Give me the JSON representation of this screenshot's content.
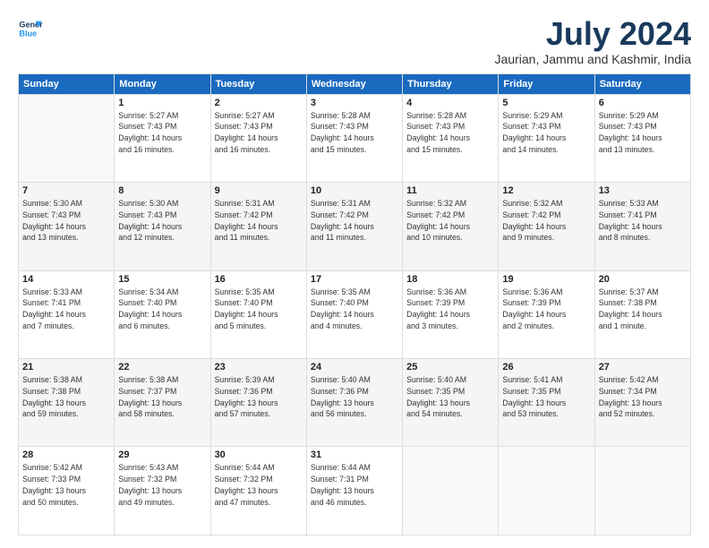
{
  "logo": {
    "line1": "General",
    "line2": "Blue"
  },
  "title": "July 2024",
  "location": "Jaurian, Jammu and Kashmir, India",
  "days_of_week": [
    "Sunday",
    "Monday",
    "Tuesday",
    "Wednesday",
    "Thursday",
    "Friday",
    "Saturday"
  ],
  "weeks": [
    [
      {
        "day": "",
        "info": ""
      },
      {
        "day": "1",
        "info": "Sunrise: 5:27 AM\nSunset: 7:43 PM\nDaylight: 14 hours\nand 16 minutes."
      },
      {
        "day": "2",
        "info": "Sunrise: 5:27 AM\nSunset: 7:43 PM\nDaylight: 14 hours\nand 16 minutes."
      },
      {
        "day": "3",
        "info": "Sunrise: 5:28 AM\nSunset: 7:43 PM\nDaylight: 14 hours\nand 15 minutes."
      },
      {
        "day": "4",
        "info": "Sunrise: 5:28 AM\nSunset: 7:43 PM\nDaylight: 14 hours\nand 15 minutes."
      },
      {
        "day": "5",
        "info": "Sunrise: 5:29 AM\nSunset: 7:43 PM\nDaylight: 14 hours\nand 14 minutes."
      },
      {
        "day": "6",
        "info": "Sunrise: 5:29 AM\nSunset: 7:43 PM\nDaylight: 14 hours\nand 13 minutes."
      }
    ],
    [
      {
        "day": "7",
        "info": "Sunrise: 5:30 AM\nSunset: 7:43 PM\nDaylight: 14 hours\nand 13 minutes."
      },
      {
        "day": "8",
        "info": "Sunrise: 5:30 AM\nSunset: 7:43 PM\nDaylight: 14 hours\nand 12 minutes."
      },
      {
        "day": "9",
        "info": "Sunrise: 5:31 AM\nSunset: 7:42 PM\nDaylight: 14 hours\nand 11 minutes."
      },
      {
        "day": "10",
        "info": "Sunrise: 5:31 AM\nSunset: 7:42 PM\nDaylight: 14 hours\nand 11 minutes."
      },
      {
        "day": "11",
        "info": "Sunrise: 5:32 AM\nSunset: 7:42 PM\nDaylight: 14 hours\nand 10 minutes."
      },
      {
        "day": "12",
        "info": "Sunrise: 5:32 AM\nSunset: 7:42 PM\nDaylight: 14 hours\nand 9 minutes."
      },
      {
        "day": "13",
        "info": "Sunrise: 5:33 AM\nSunset: 7:41 PM\nDaylight: 14 hours\nand 8 minutes."
      }
    ],
    [
      {
        "day": "14",
        "info": "Sunrise: 5:33 AM\nSunset: 7:41 PM\nDaylight: 14 hours\nand 7 minutes."
      },
      {
        "day": "15",
        "info": "Sunrise: 5:34 AM\nSunset: 7:40 PM\nDaylight: 14 hours\nand 6 minutes."
      },
      {
        "day": "16",
        "info": "Sunrise: 5:35 AM\nSunset: 7:40 PM\nDaylight: 14 hours\nand 5 minutes."
      },
      {
        "day": "17",
        "info": "Sunrise: 5:35 AM\nSunset: 7:40 PM\nDaylight: 14 hours\nand 4 minutes."
      },
      {
        "day": "18",
        "info": "Sunrise: 5:36 AM\nSunset: 7:39 PM\nDaylight: 14 hours\nand 3 minutes."
      },
      {
        "day": "19",
        "info": "Sunrise: 5:36 AM\nSunset: 7:39 PM\nDaylight: 14 hours\nand 2 minutes."
      },
      {
        "day": "20",
        "info": "Sunrise: 5:37 AM\nSunset: 7:38 PM\nDaylight: 14 hours\nand 1 minute."
      }
    ],
    [
      {
        "day": "21",
        "info": "Sunrise: 5:38 AM\nSunset: 7:38 PM\nDaylight: 13 hours\nand 59 minutes."
      },
      {
        "day": "22",
        "info": "Sunrise: 5:38 AM\nSunset: 7:37 PM\nDaylight: 13 hours\nand 58 minutes."
      },
      {
        "day": "23",
        "info": "Sunrise: 5:39 AM\nSunset: 7:36 PM\nDaylight: 13 hours\nand 57 minutes."
      },
      {
        "day": "24",
        "info": "Sunrise: 5:40 AM\nSunset: 7:36 PM\nDaylight: 13 hours\nand 56 minutes."
      },
      {
        "day": "25",
        "info": "Sunrise: 5:40 AM\nSunset: 7:35 PM\nDaylight: 13 hours\nand 54 minutes."
      },
      {
        "day": "26",
        "info": "Sunrise: 5:41 AM\nSunset: 7:35 PM\nDaylight: 13 hours\nand 53 minutes."
      },
      {
        "day": "27",
        "info": "Sunrise: 5:42 AM\nSunset: 7:34 PM\nDaylight: 13 hours\nand 52 minutes."
      }
    ],
    [
      {
        "day": "28",
        "info": "Sunrise: 5:42 AM\nSunset: 7:33 PM\nDaylight: 13 hours\nand 50 minutes."
      },
      {
        "day": "29",
        "info": "Sunrise: 5:43 AM\nSunset: 7:32 PM\nDaylight: 13 hours\nand 49 minutes."
      },
      {
        "day": "30",
        "info": "Sunrise: 5:44 AM\nSunset: 7:32 PM\nDaylight: 13 hours\nand 47 minutes."
      },
      {
        "day": "31",
        "info": "Sunrise: 5:44 AM\nSunset: 7:31 PM\nDaylight: 13 hours\nand 46 minutes."
      },
      {
        "day": "",
        "info": ""
      },
      {
        "day": "",
        "info": ""
      },
      {
        "day": "",
        "info": ""
      }
    ]
  ]
}
